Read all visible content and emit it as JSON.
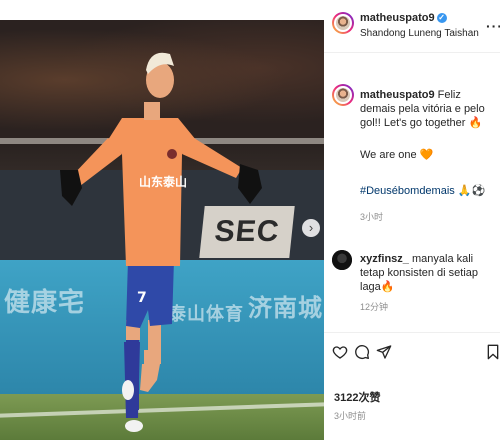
{
  "photo": {
    "ad_text_left": "健康宅",
    "ad_text_mid": "泰山体育",
    "ad_text_right": "济南城",
    "board_text": "SEC",
    "shirt_text": "山东泰山",
    "shirt_number": "7",
    "next_icon": "›"
  },
  "header": {
    "username": "matheuspato9",
    "verified_glyph": "✓",
    "location": "Shandong Luneng Taishan Football C",
    "more_glyph": "···"
  },
  "caption": {
    "username": "matheuspato9",
    "text_line1": "Feliz demais pela vitória e pelo gol!! Let's go together 🔥",
    "text_line2": "We are one 🧡",
    "hashtag": "#Deusébomdemais 🙏⚽",
    "time": "3小时"
  },
  "comment": {
    "username": "xyzfinsz_",
    "text": "manyala kali tetap konsisten di setiap laga🔥",
    "time": "12分钟"
  },
  "footer": {
    "likes": "3122次赞",
    "time": "3小时前"
  },
  "icons": [
    "heart-icon",
    "comment-icon",
    "share-icon",
    "bookmark-icon",
    "verified-icon",
    "more-icon",
    "next-icon"
  ]
}
